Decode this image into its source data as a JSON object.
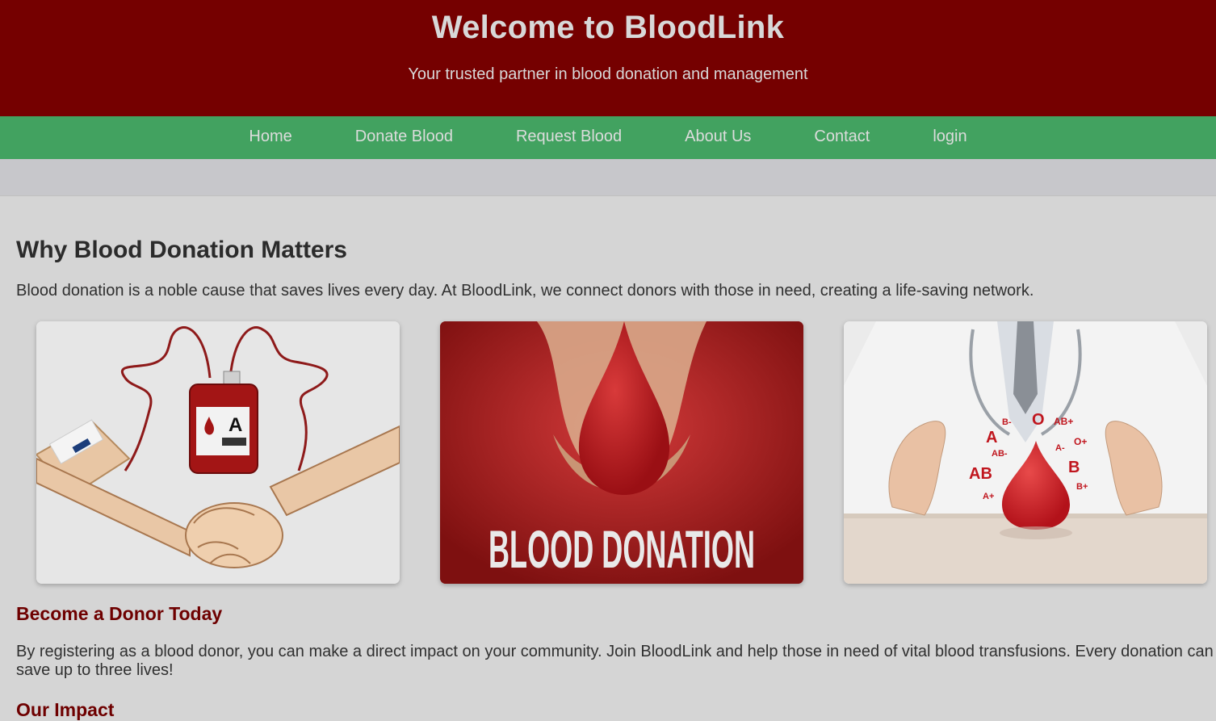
{
  "header": {
    "title": "Welcome to BloodLink",
    "subtitle": "Your trusted partner in blood donation and management"
  },
  "nav": {
    "items": [
      {
        "label": "Home"
      },
      {
        "label": "Donate Blood"
      },
      {
        "label": "Request Blood"
      },
      {
        "label": "About Us"
      },
      {
        "label": "Contact"
      },
      {
        "label": "login"
      }
    ]
  },
  "main": {
    "heading": "Why Blood Donation Matters",
    "intro": "Blood donation is a noble cause that saves lives every day. At BloodLink, we connect donors with those in need, creating a life-saving network.",
    "images": {
      "bag_letter": "A",
      "banner_text": "BLOOD DONATION",
      "blood_types": [
        "B-",
        "O",
        "AB+",
        "A",
        "AB-",
        "A-",
        "O+",
        "AB",
        "B",
        "A+",
        "B+"
      ]
    },
    "donor_heading": "Become a Donor Today",
    "donor_text": "By registering as a blood donor, you can make a direct impact on your community. Join BloodLink and help those in need of vital blood transfusions. Every donation can save up to three lives!",
    "impact_heading": "Our Impact"
  },
  "colors": {
    "header_bg": "#750000",
    "nav_bg": "#42a260",
    "accent_heading": "#6e0000"
  }
}
